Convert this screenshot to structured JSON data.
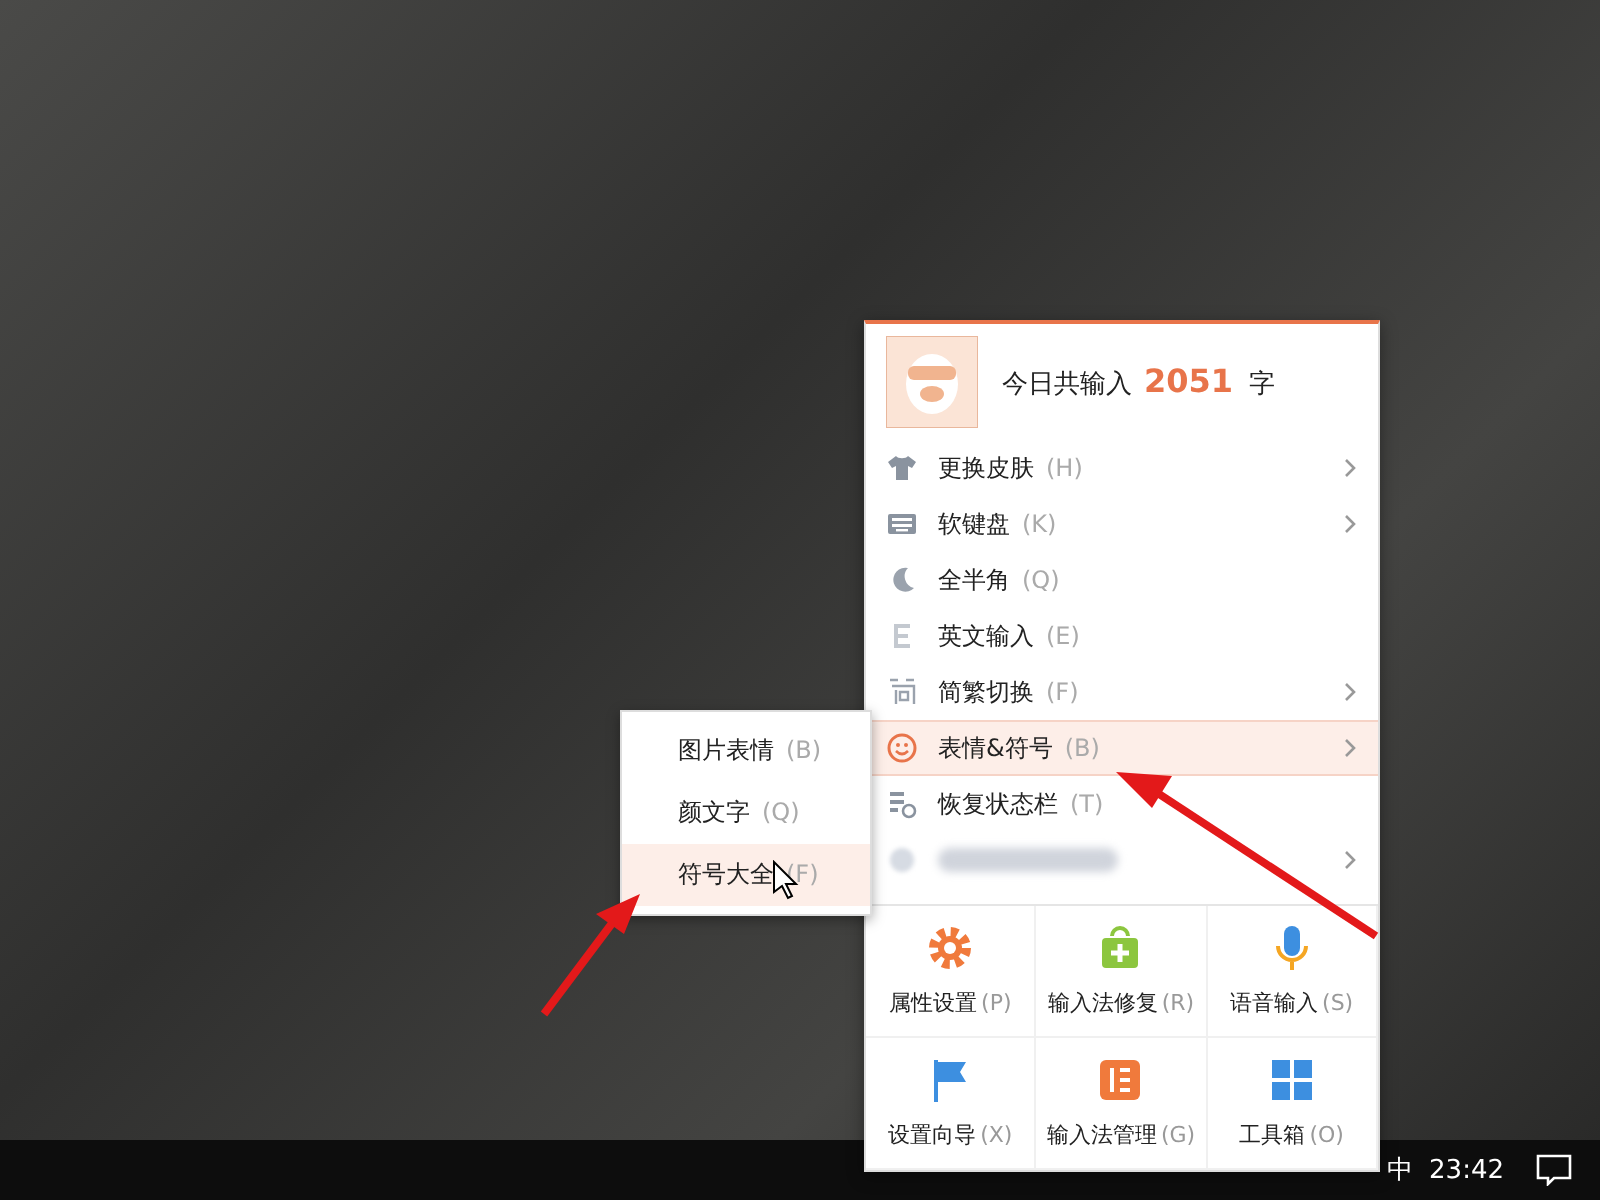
{
  "header": {
    "label": "今日共输入",
    "count": "2051",
    "unit": "字"
  },
  "menu_items": [
    {
      "kind": "shirt",
      "label": "更换皮肤",
      "shortcut": "(H)",
      "has_submenu": true,
      "selected": false
    },
    {
      "kind": "keyboard",
      "label": "软键盘",
      "shortcut": "(K)",
      "has_submenu": true,
      "selected": false
    },
    {
      "kind": "moon",
      "label": "全半角",
      "shortcut": "(Q)",
      "has_submenu": false,
      "selected": false
    },
    {
      "kind": "letter",
      "label": "英文输入",
      "shortcut": "(E)",
      "has_submenu": false,
      "selected": false
    },
    {
      "kind": "jian",
      "label": "简繁切换",
      "shortcut": "(F)",
      "has_submenu": true,
      "selected": false
    },
    {
      "kind": "smiley",
      "label": "表情&符号",
      "shortcut": "(B)",
      "has_submenu": true,
      "selected": true
    },
    {
      "kind": "statusbar",
      "label": "恢复状态栏",
      "shortcut": "(T)",
      "has_submenu": false,
      "selected": false
    },
    {
      "kind": "blurred",
      "has_submenu": true,
      "selected": false
    }
  ],
  "submenu": [
    {
      "label": "图片表情",
      "shortcut": "(B)",
      "selected": false
    },
    {
      "label": "颜文字",
      "shortcut": "(Q)",
      "selected": false
    },
    {
      "label": "符号大全",
      "shortcut": "(F)",
      "selected": true
    }
  ],
  "tools": [
    {
      "kind": "gear",
      "label": "属性设置",
      "shortcut": "(P)"
    },
    {
      "kind": "repair",
      "label": "输入法修复",
      "shortcut": "(R)"
    },
    {
      "kind": "mic",
      "label": "语音输入",
      "shortcut": "(S)"
    },
    {
      "kind": "flag",
      "label": "设置向导",
      "shortcut": "(X)"
    },
    {
      "kind": "manage",
      "label": "输入法管理",
      "shortcut": "(G)"
    },
    {
      "kind": "toolbox",
      "label": "工具箱",
      "shortcut": "(O)"
    }
  ],
  "taskbar": {
    "ime": "中",
    "clock": "23:42"
  }
}
